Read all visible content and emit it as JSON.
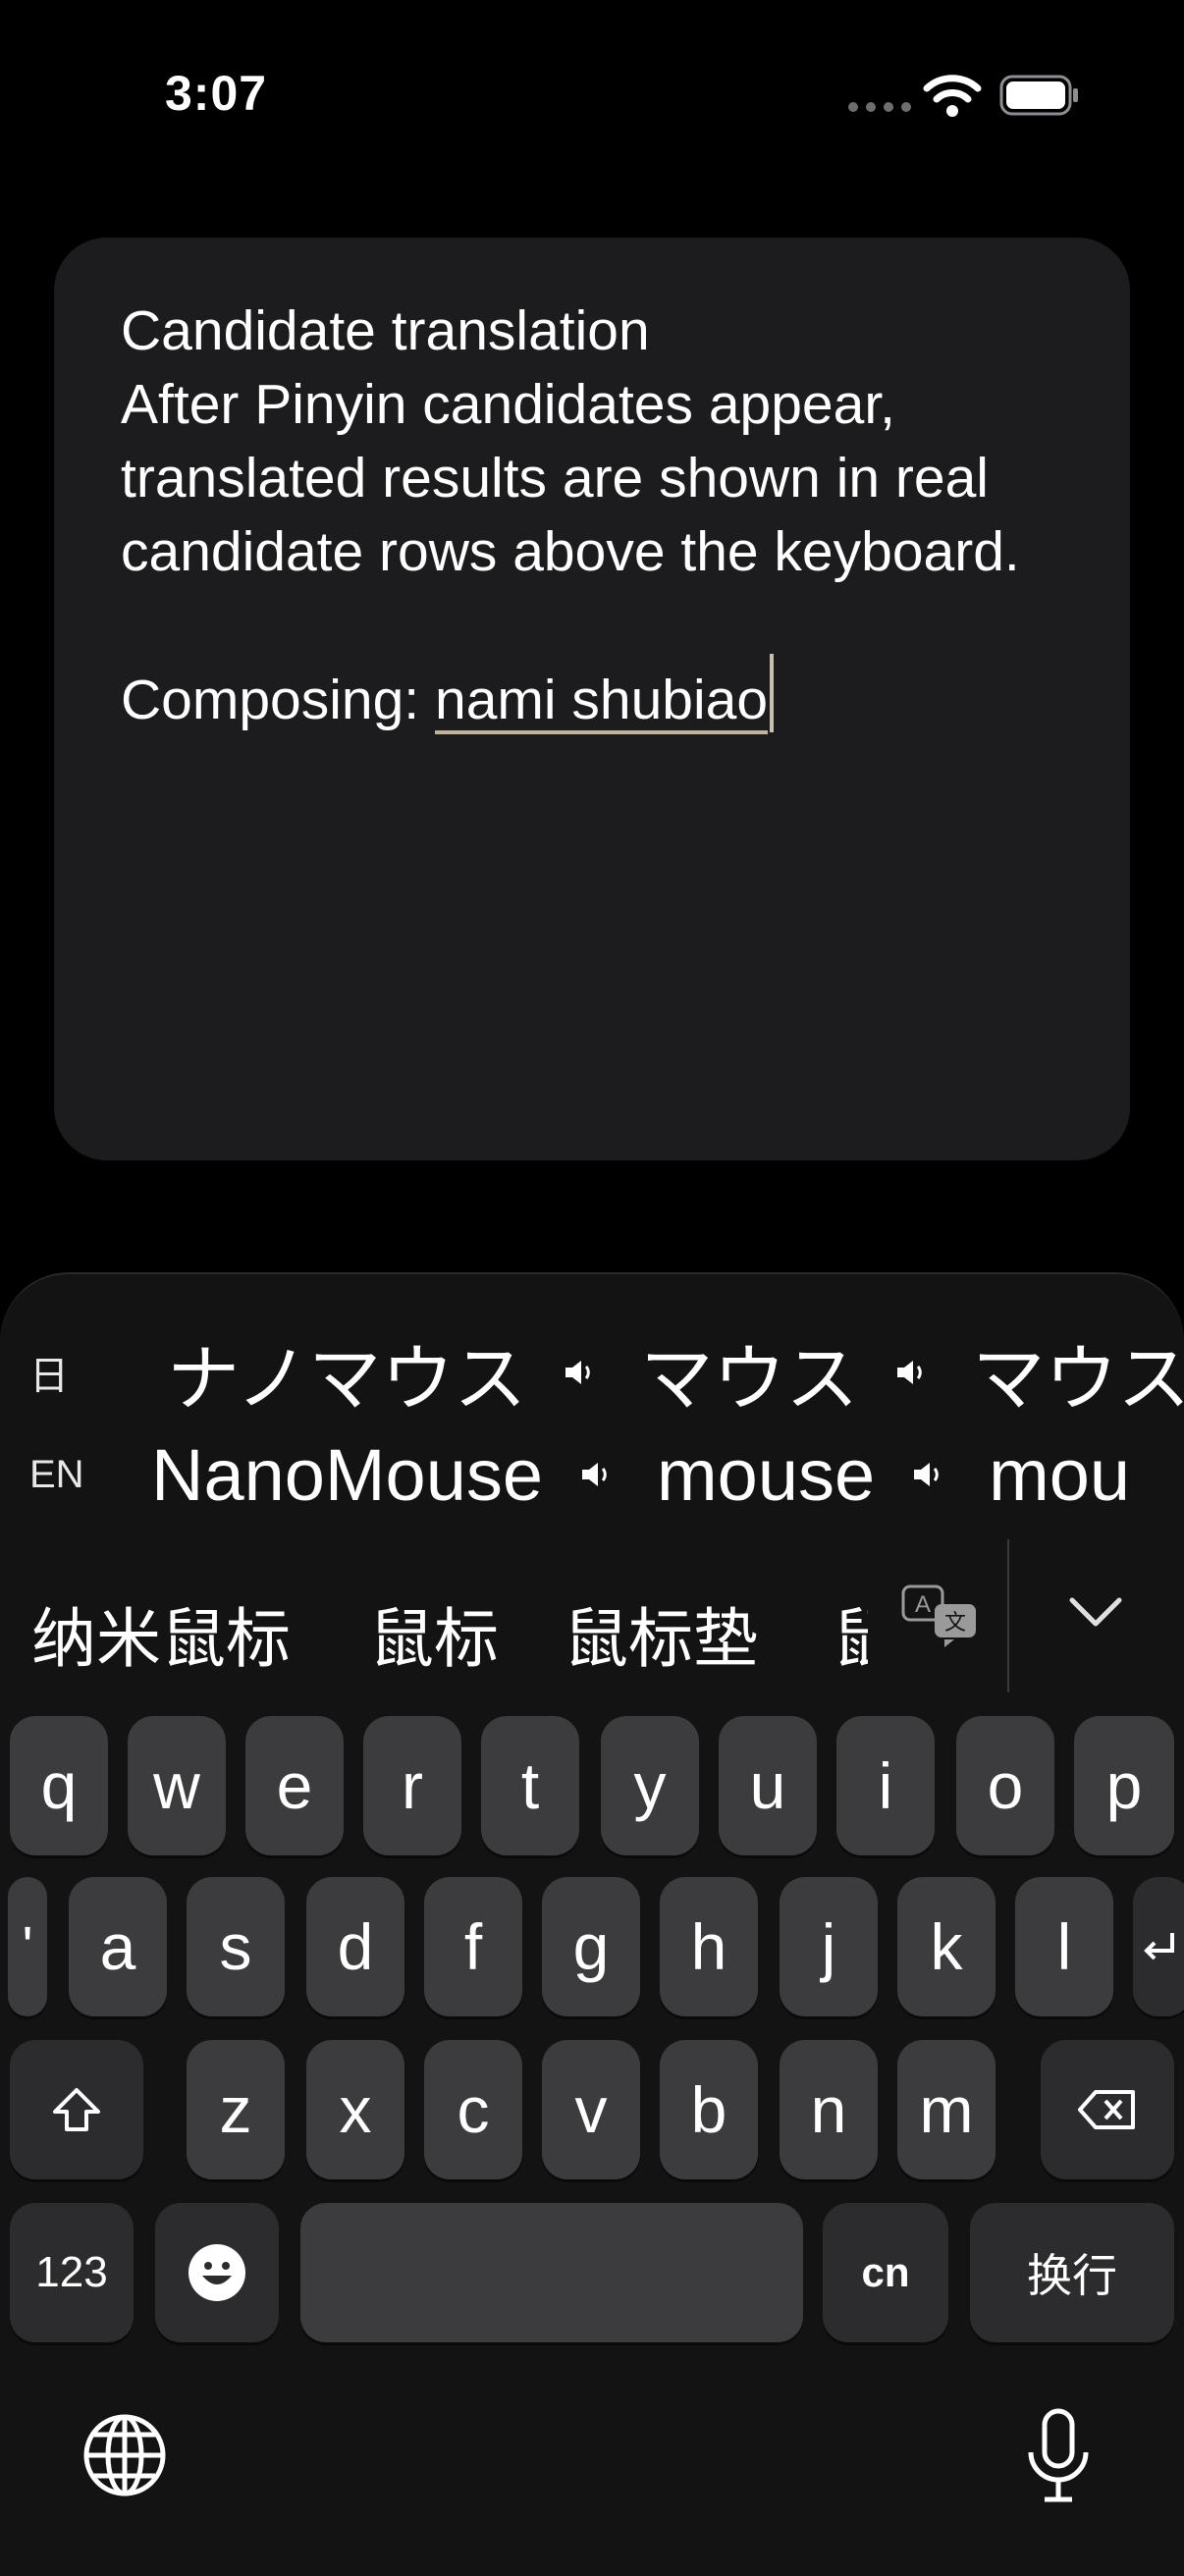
{
  "status_bar": {
    "time": "3:07"
  },
  "card": {
    "lines": "Candidate translation\nAfter Pinyin candidates appear,\ntranslated results are shown in real\ncandidate rows above the keyboard.",
    "composing_label": "Composing: ",
    "composing_value": "nami shubiao"
  },
  "translation_rows": {
    "ja": {
      "lang": "日",
      "candidates": [
        "ナノマウス",
        "マウス",
        "マウス"
      ]
    },
    "en": {
      "lang": "EN",
      "candidates": [
        "NanoMouse",
        "mouse",
        "mou"
      ]
    }
  },
  "pinyin_candidates": [
    "纳米鼠标",
    "鼠标",
    "鼠标垫",
    "鼠"
  ],
  "keys": {
    "row1": [
      "q",
      "w",
      "e",
      "r",
      "t",
      "y",
      "u",
      "i",
      "o",
      "p"
    ],
    "row2": [
      "'",
      "a",
      "s",
      "d",
      "f",
      "g",
      "h",
      "j",
      "k",
      "l"
    ],
    "row3": [
      "z",
      "x",
      "c",
      "v",
      "b",
      "n",
      "m"
    ],
    "numbers": "123",
    "lang_switch": "cn",
    "return": "换行"
  },
  "icons": {
    "speaker": "speaker-icon",
    "translate": "translate-icon",
    "collapse": "chevron-down-icon",
    "shift": "shift-icon",
    "delete": "delete-icon",
    "emoji": "emoji-icon",
    "globe": "globe-icon",
    "mic": "microphone-icon",
    "return": "return-arrow-icon"
  }
}
